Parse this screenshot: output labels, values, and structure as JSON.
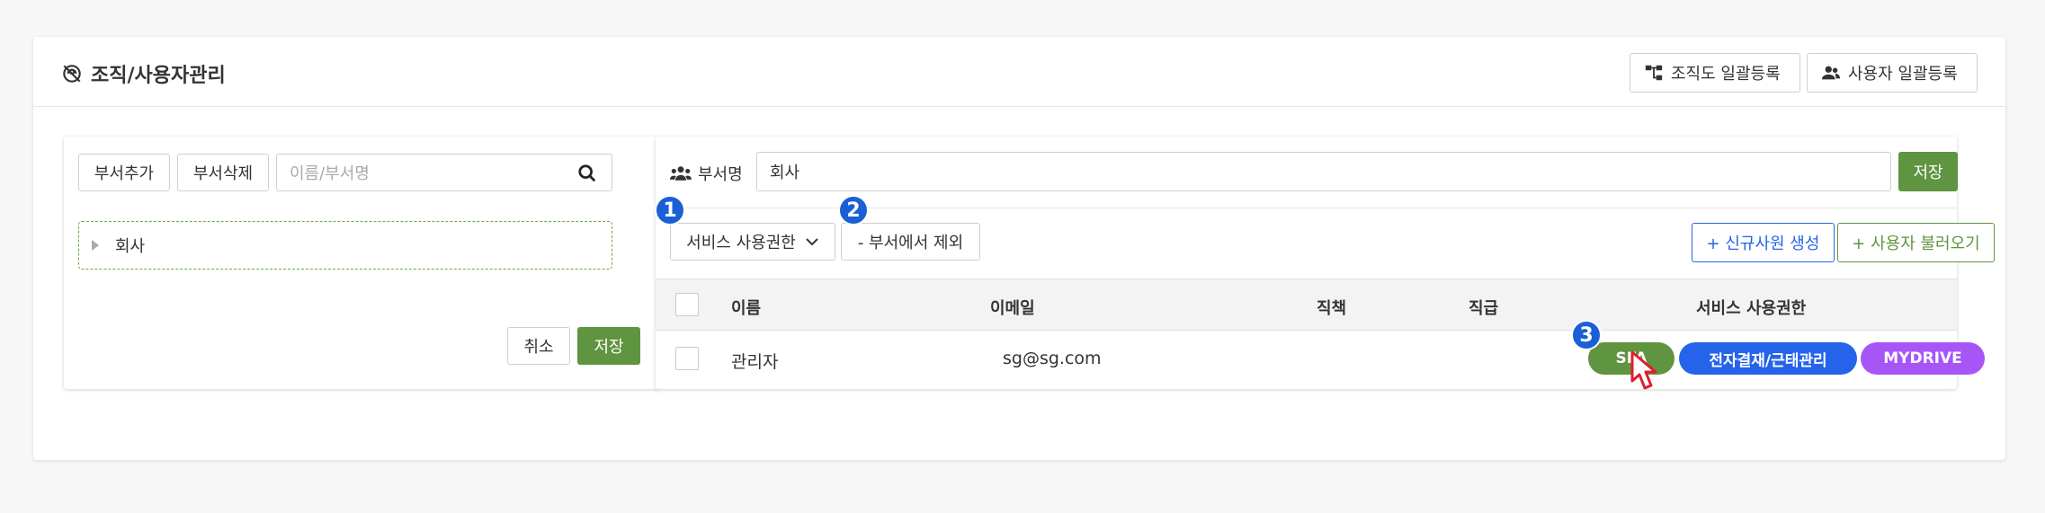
{
  "header": {
    "title": "조직/사용자관리",
    "org_chart_bulk_label": "조직도 일괄등록",
    "user_bulk_label": "사용자 일괄등록"
  },
  "left_panel": {
    "add_dept_label": "부서추가",
    "delete_dept_label": "부서삭제",
    "search_placeholder": "이름/부서명",
    "tree_root": "회사",
    "cancel_label": "취소",
    "save_label": "저장"
  },
  "right_panel": {
    "dept_name_label": "부서명",
    "dept_name_value": "회사",
    "save_label": "저장",
    "service_permission_label": "서비스 사용권한",
    "remove_from_dept_label": "- 부서에서 제외",
    "new_employee_label": "+ 신규사원 생성",
    "import_user_label": "+ 사용자 불러오기",
    "markers": [
      "1",
      "2",
      "3"
    ],
    "table": {
      "columns": [
        "이름",
        "이메일",
        "직책",
        "직급",
        "서비스 사용권한"
      ],
      "rows": [
        {
          "name": "관리자",
          "email": "sg@sg.com",
          "position": "",
          "rank": "",
          "services": [
            {
              "label": "SFA",
              "color": "#5f9440"
            },
            {
              "label": "전자결재/근태관리",
              "color": "#2563eb"
            },
            {
              "label": "MYDRIVE",
              "color": "#a855f7"
            }
          ]
        }
      ]
    }
  },
  "colors": {
    "accent_green": "#5f9440",
    "accent_blue": "#2563eb",
    "badge_blue": "#1a5fd6"
  }
}
